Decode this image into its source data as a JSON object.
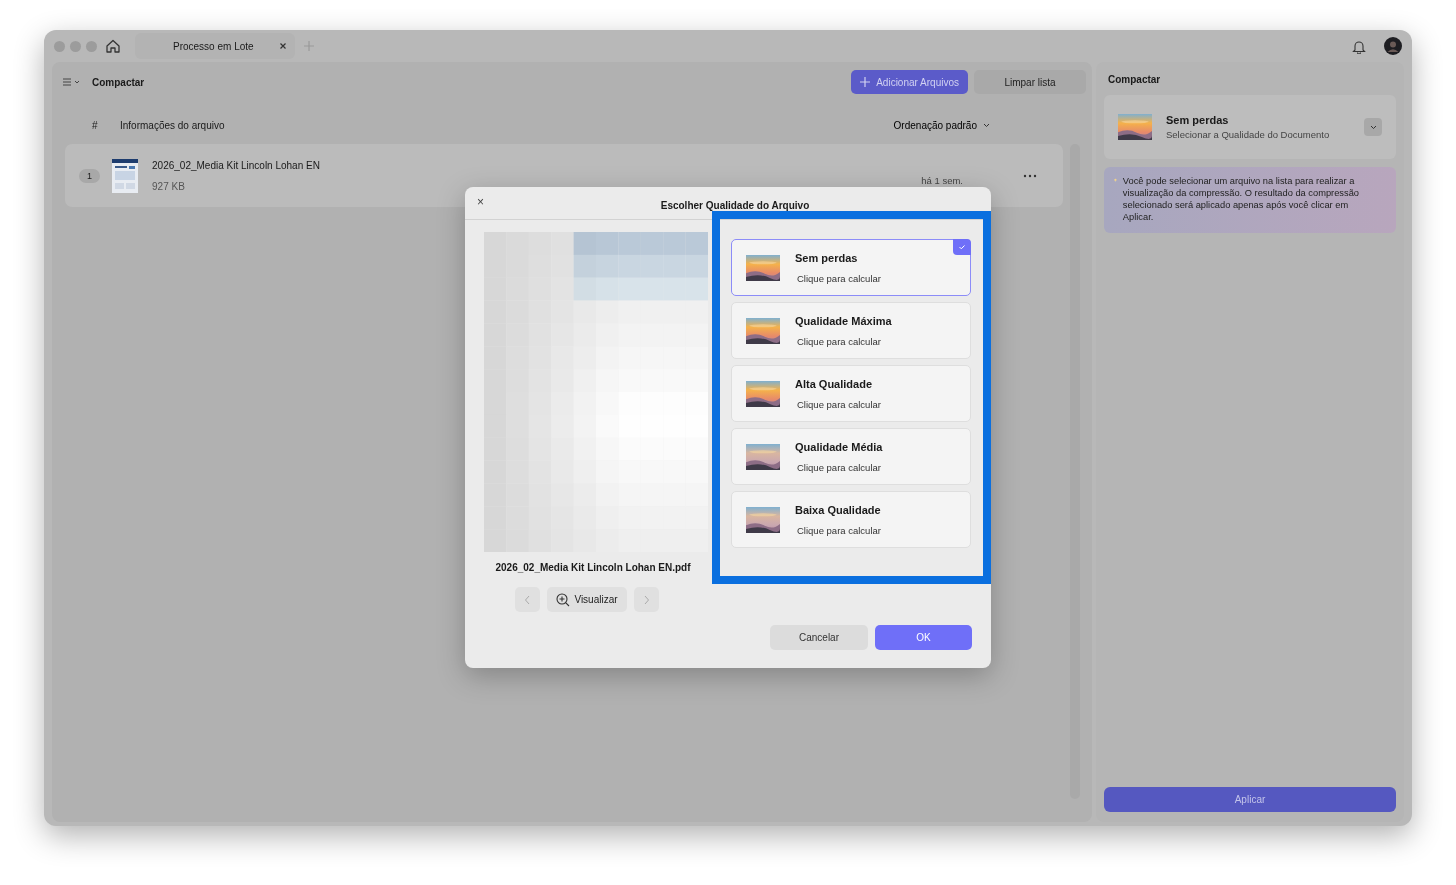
{
  "window": {
    "tab": {
      "title": "Processo em Lote"
    }
  },
  "toolbar": {
    "mode": "Compactar",
    "add_button": "Adicionar Arquivos",
    "clear_button": "Limpar lista"
  },
  "table": {
    "columns": [
      "#",
      "Informações do arquivo"
    ],
    "sort": "Ordenação padrão",
    "rows": [
      {
        "index": "1",
        "name": "2026_02_Media Kit Lincoln Lohan EN",
        "size": "927 KB",
        "time": "há 1 sem."
      }
    ]
  },
  "side_panel": {
    "title": "Compactar",
    "quality": {
      "title": "Sem perdas",
      "subtitle": "Selecionar a Qualidade do Documento"
    },
    "tip": "Você pode selecionar um arquivo na lista para realizar a visualização da compressão. O resultado da compressão selecionado será aplicado apenas após você clicar em Aplicar.",
    "apply_button": "Aplicar"
  },
  "dialog": {
    "title": "Escolher Qualidade do Arquivo",
    "close": "×",
    "filename": "2026_02_Media Kit Lincoln Lohan EN.pdf",
    "preview_button": "Visualizar",
    "options": [
      {
        "title": "Sem perdas",
        "subtitle": "Clique para calcular",
        "selected": true
      },
      {
        "title": "Qualidade Máxima",
        "subtitle": "Clique para calcular",
        "selected": false
      },
      {
        "title": "Alta Qualidade",
        "subtitle": "Clique para calcular",
        "selected": false
      },
      {
        "title": "Qualidade Média",
        "subtitle": "Clique para calcular",
        "selected": false
      },
      {
        "title": "Baixa Qualidade",
        "subtitle": "Clique para calcular",
        "selected": false
      }
    ],
    "cancel_button": "Cancelar",
    "ok_button": "OK"
  }
}
